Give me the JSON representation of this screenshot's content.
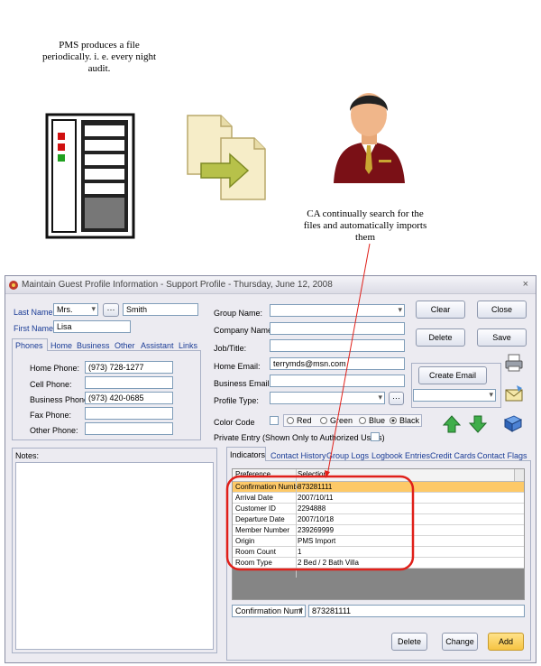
{
  "diagram": {
    "pms_caption": "PMS produces a file periodically. i. e. every night audit.",
    "ca_caption": "CA continually search for the files and automatically imports them",
    "server_icon": "server-rack-icon",
    "files_icon": "file-transfer-icon",
    "person_icon": "businessman-icon"
  },
  "window": {
    "title": "Maintain Guest Profile Information - Support Profile - Thursday, June 12, 2008",
    "close": "×"
  },
  "left": {
    "last_name_label": "Last Name:",
    "salutation": "Mrs.",
    "ellipsis": "···",
    "last_name": "Smith",
    "first_name_label": "First Name:",
    "first_name": "Lisa",
    "tabs": [
      "Phones",
      "Home",
      "Business",
      "Other",
      "Assistant",
      "Links"
    ],
    "phones": [
      {
        "label": "Home Phone:",
        "value": "(973) 728-1277"
      },
      {
        "label": "Cell Phone:",
        "value": ""
      },
      {
        "label": "Business Phone:",
        "value": "(973) 420-0685"
      },
      {
        "label": "Fax Phone:",
        "value": ""
      },
      {
        "label": "Other Phone:",
        "value": ""
      }
    ],
    "notes_label": "Notes:"
  },
  "right": {
    "group_name_label": "Group Name:",
    "company_name_label": "Company Name:",
    "job_title_label": "Job/Title:",
    "home_email_label": "Home Email:",
    "home_email": "terrymds@msn.com",
    "business_email_label": "Business Email:",
    "profile_type_label": "Profile Type:",
    "color_code_label": "Color Code",
    "colors": [
      "Red",
      "Green",
      "Blue",
      "Black"
    ],
    "private_entry_label": "Private Entry (Shown Only to Authorized Users)",
    "buttons": {
      "clear": "Clear",
      "close": "Close",
      "delete": "Delete",
      "save": "Save",
      "create_email": "Create Email"
    }
  },
  "indicators": {
    "tabs": [
      "Indicators",
      "Contact History",
      "Group Logs",
      "Logbook Entries",
      "Credit Cards",
      "Contact Flags"
    ],
    "columns": [
      "Preference",
      "Selection"
    ],
    "rows": [
      {
        "pref": "Confirmation Numb",
        "sel": "873281111"
      },
      {
        "pref": "Arrival Date",
        "sel": "2007/10/11"
      },
      {
        "pref": "Customer ID",
        "sel": "2294888"
      },
      {
        "pref": "Departure Date",
        "sel": "2007/10/18"
      },
      {
        "pref": "Member Number",
        "sel": "239269999"
      },
      {
        "pref": "Origin",
        "sel": "PMS Import"
      },
      {
        "pref": "Room Count",
        "sel": "1"
      },
      {
        "pref": "Room Type",
        "sel": "2 Bed / 2 Bath Villa"
      }
    ],
    "bottom_select": "Confirmation Numl",
    "bottom_value": "873281111",
    "buttons": {
      "delete": "Delete",
      "change": "Change",
      "add": "Add"
    }
  },
  "colors": {
    "highlight": "#fdc968",
    "annotation": "#e0201a",
    "add_button": "#f6c443"
  }
}
